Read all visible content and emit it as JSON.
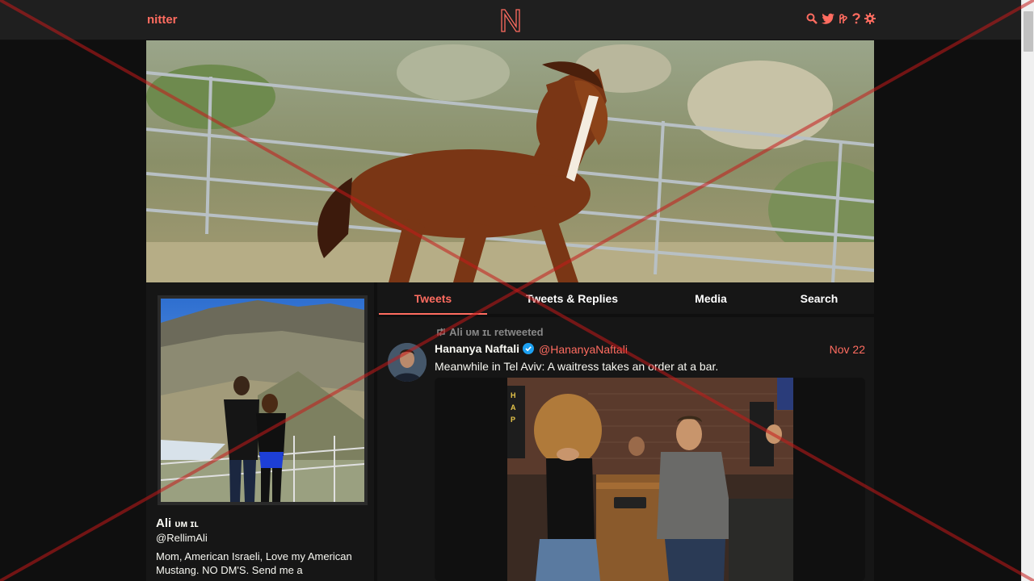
{
  "nav": {
    "brand": "nitter",
    "logo_letter": "N",
    "icons": [
      "search-icon",
      "twitter-bird-icon",
      "rss-icon",
      "help-icon",
      "gear-icon"
    ]
  },
  "profile": {
    "fullname": "Ali",
    "fullname_suffix": "ᴜᴍ ɪʟ",
    "username": "@RellimAli",
    "bio": "Mom, American Israeli, Love my American Mustang. NO DM'S. Send me a"
  },
  "tabs": [
    {
      "label": "Tweets",
      "active": true
    },
    {
      "label": "Tweets & Replies",
      "active": false
    },
    {
      "label": "Media",
      "active": false
    },
    {
      "label": "Search",
      "active": false
    }
  ],
  "tweet": {
    "retweet_header": "Ali ᴜᴍ ɪʟ retweeted",
    "fullname": "Hananya Naftali",
    "handle": "@HananyaNaftali",
    "date": "Nov 22",
    "text": "Meanwhile in Tel Aviv: A waitress takes an order at a bar."
  },
  "colors": {
    "accent": "#ff6c60",
    "background": "#0f0f0f",
    "panel": "#161616",
    "nav": "#1f1f1f"
  }
}
